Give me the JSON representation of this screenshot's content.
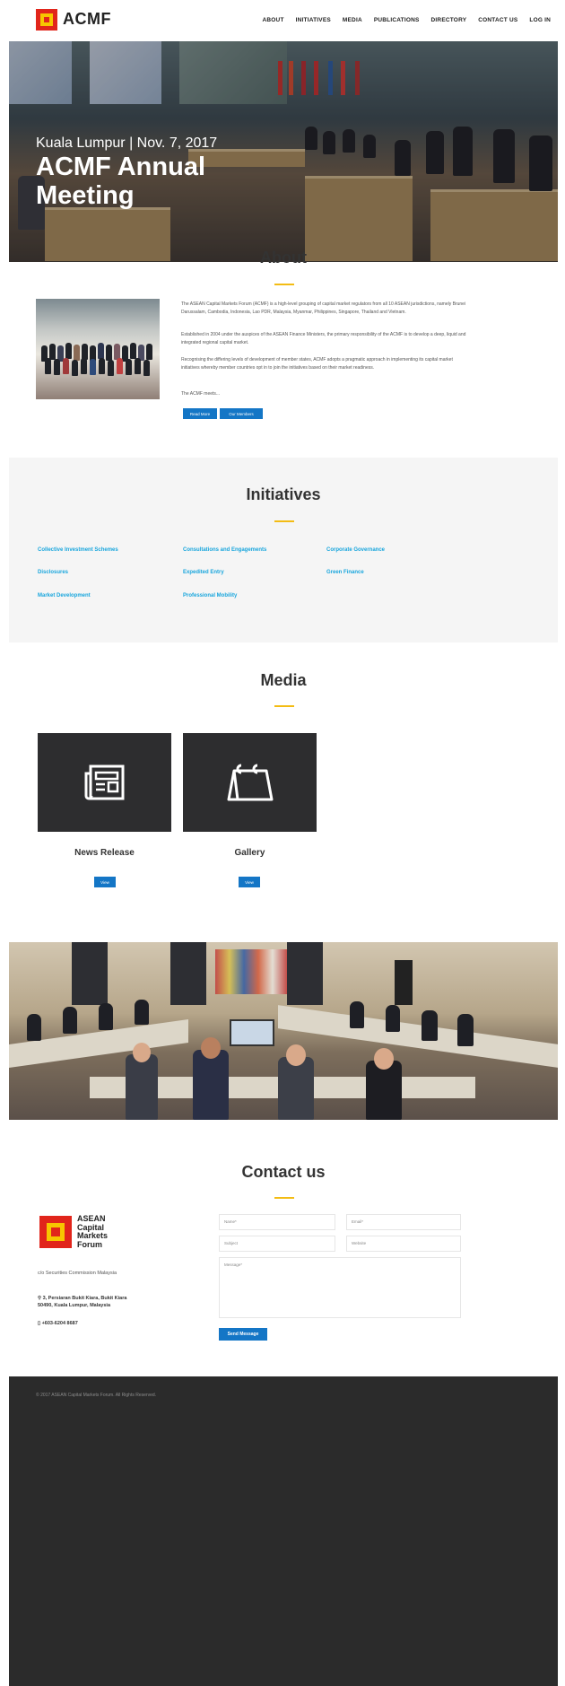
{
  "brand": {
    "logo_text": "ACMF",
    "contact_logo_text": "ASEAN Capital Markets Forum",
    "accent_red": "#e1251b",
    "accent_yellow": "#f7c600",
    "link_blue": "#19a6dd",
    "button_blue": "#1476c6"
  },
  "nav": [
    "ABOUT",
    "INITIATIVES",
    "MEDIA",
    "PUBLICATIONS",
    "DIRECTORY",
    "CONTACT US",
    "LOG IN"
  ],
  "hero": {
    "subtitle": "Kuala Lumpur | Nov. 7, 2017",
    "title": "ACMF Annual Meeting"
  },
  "about": {
    "title": "About",
    "paragraphs": [
      "The ASEAN Capital Markets Forum (ACMF) is a high-level grouping of capital market regulators from all 10 ASEAN jurisdictions, namely Brunei Darussalam, Cambodia, Indonesia, Lao PDR, Malaysia, Myanmar, Philippines, Singapore, Thailand and Vietnam.",
      "Established in 2004 under the auspices of the ASEAN Finance Ministers, the primary responsibility of the ACMF is to develop a deep, liquid and integrated regional capital market.",
      "Recognising the differing levels of development of member states, ACMF adopts a pragmatic approach in implementing its capital market initiatives whereby member countries opt in to join the initiatives based on their market readiness.",
      "The ACMF meets..."
    ],
    "buttons": [
      "Read More",
      "Our Members"
    ]
  },
  "initiatives": {
    "title": "Initiatives",
    "items": [
      "Collective Investment Schemes",
      "Consultations and Engagements",
      "Corporate Governance",
      "Disclosures",
      "Expedited Entry",
      "Green Finance",
      "Market Development",
      "Professional Mobility"
    ]
  },
  "media": {
    "title": "Media",
    "tiles": [
      {
        "label": "News Release",
        "button": "View",
        "icon": "newspaper-icon"
      },
      {
        "label": "Gallery",
        "button": "View",
        "icon": "calendar-icon"
      }
    ]
  },
  "contact": {
    "title": "Contact us",
    "care_of": "c/o Securities Commission Malaysia",
    "address_line1": "3, Persiaran Bukit Kiara, Bukit Kiara",
    "address_line2": "50490, Kuala Lumpur, Malaysia",
    "phone": "+603-6204 8687",
    "fields": {
      "name": "Name*",
      "email": "Email*",
      "subject": "Subject",
      "website": "Website",
      "message": "Message*"
    },
    "send_button": "Send Message"
  },
  "footer": {
    "copyright": "© 2017 ASEAN Capital Markets Forum. All Rights Reserved."
  }
}
